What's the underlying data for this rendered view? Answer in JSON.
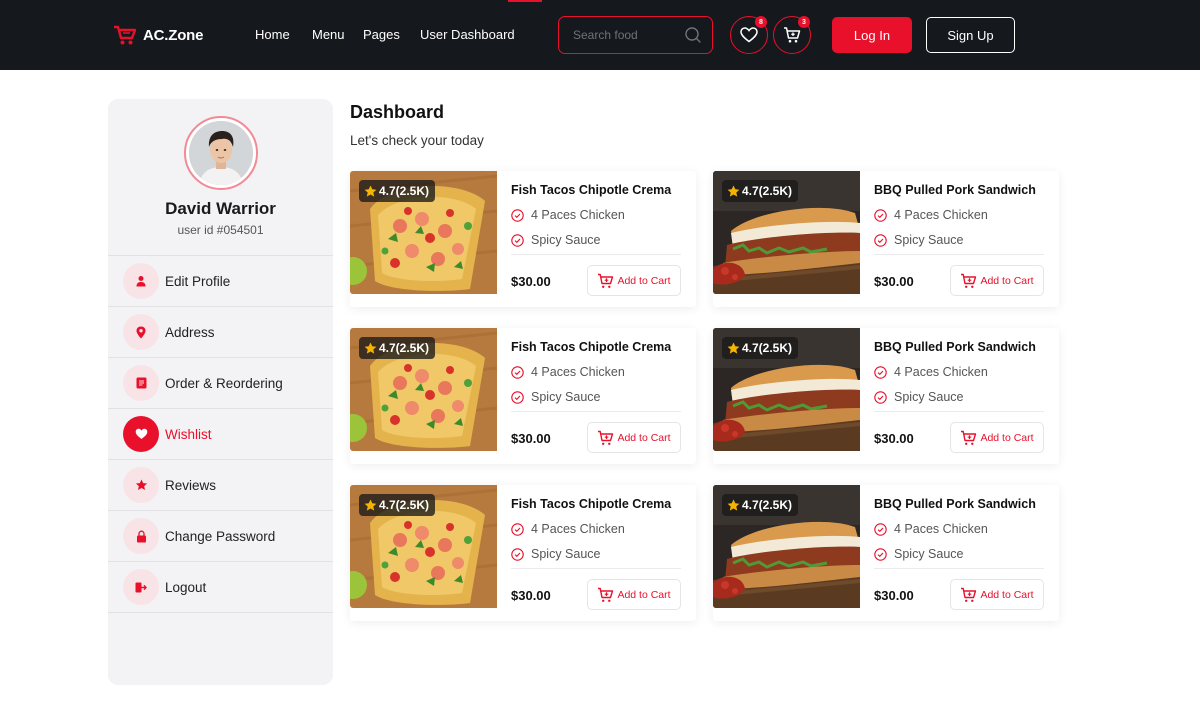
{
  "header": {
    "brand": "AC.Zone",
    "nav": [
      "Home",
      "Menu",
      "Pages",
      "User Dashboard"
    ],
    "search_placeholder": "Search food",
    "wishlist_count": "8",
    "cart_count": "3",
    "login_label": "Log In",
    "signup_label": "Sign Up"
  },
  "profile": {
    "name": "David Warrior",
    "user_id": "user id #054501"
  },
  "sidebar": {
    "items": [
      {
        "label": "Edit Profile",
        "icon": "user-icon"
      },
      {
        "label": "Address",
        "icon": "location-pin-icon"
      },
      {
        "label": "Order & Reordering",
        "icon": "order-list-icon"
      },
      {
        "label": "Wishlist",
        "icon": "heart-icon",
        "active": true
      },
      {
        "label": "Reviews",
        "icon": "star-icon"
      },
      {
        "label": "Change Password",
        "icon": "lock-icon"
      },
      {
        "label": "Logout",
        "icon": "logout-icon"
      }
    ]
  },
  "main": {
    "title": "Dashboard",
    "subtitle": "Let's check your today"
  },
  "products": [
    {
      "title": "Fish Tacos Chipotle Crema",
      "rating": "4.7(2.5K)",
      "feature1": "4 Paces Chicken",
      "feature2": "Spicy Sauce",
      "price": "$30.00",
      "add_label": "Add to Cart",
      "image": "taco"
    },
    {
      "title": "BBQ Pulled Pork Sandwich",
      "rating": "4.7(2.5K)",
      "feature1": "4 Paces Chicken",
      "feature2": "Spicy Sauce",
      "price": "$30.00",
      "add_label": "Add to Cart",
      "image": "sandwich"
    },
    {
      "title": "Fish Tacos Chipotle Crema",
      "rating": "4.7(2.5K)",
      "feature1": "4 Paces Chicken",
      "feature2": "Spicy Sauce",
      "price": "$30.00",
      "add_label": "Add to Cart",
      "image": "taco"
    },
    {
      "title": "BBQ Pulled Pork Sandwich",
      "rating": "4.7(2.5K)",
      "feature1": "4 Paces Chicken",
      "feature2": "Spicy Sauce",
      "price": "$30.00",
      "add_label": "Add to Cart",
      "image": "sandwich"
    },
    {
      "title": "Fish Tacos Chipotle Crema",
      "rating": "4.7(2.5K)",
      "feature1": "4 Paces Chicken",
      "feature2": "Spicy Sauce",
      "price": "$30.00",
      "add_label": "Add to Cart",
      "image": "taco"
    },
    {
      "title": "BBQ Pulled Pork Sandwich",
      "rating": "4.7(2.5K)",
      "feature1": "4 Paces Chicken",
      "feature2": "Spicy Sauce",
      "price": "$30.00",
      "add_label": "Add to Cart",
      "image": "sandwich"
    }
  ],
  "colors": {
    "accent": "#e8102b",
    "header_bg": "#15181c",
    "sidebar_bg": "#f3f3f5"
  }
}
